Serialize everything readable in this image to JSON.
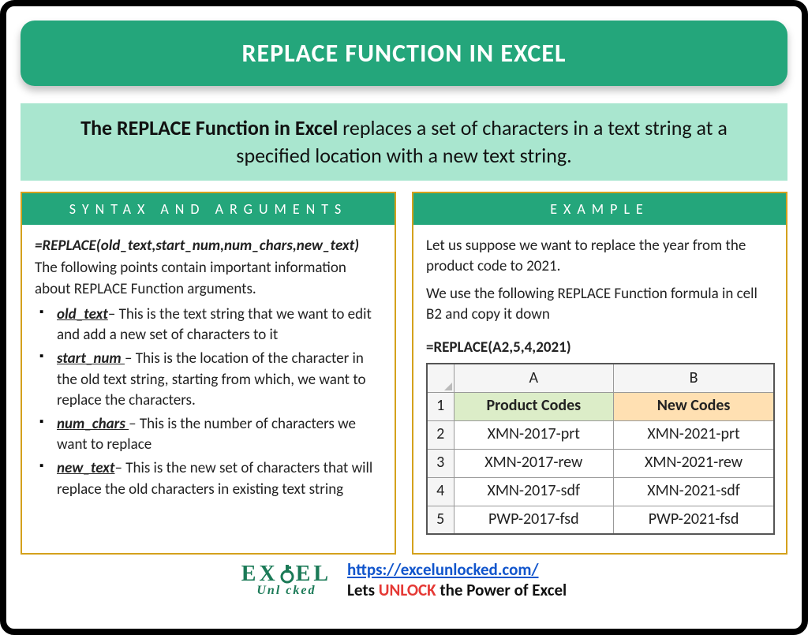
{
  "title": "REPLACE FUNCTION IN EXCEL",
  "description": {
    "bold": "The REPLACE Function in Excel",
    "rest": " replaces a set of characters in a text string at a specified location with a new text string."
  },
  "left": {
    "header": "SYNTAX AND ARGUMENTS",
    "syntax": "=REPLACE(old_text,start_num,num_chars,new_text)",
    "intro": "The following points contain important information about REPLACE Function arguments.",
    "args": [
      {
        "name": "old_text",
        "desc": "– This is the text string that we want to edit and add a new set of characters to it"
      },
      {
        "name": "start_num ",
        "desc": "– This is the location of the character in the old text string, starting from which, we want to replace the characters."
      },
      {
        "name": "num_chars ",
        "desc": "– This is the number of characters we want to replace"
      },
      {
        "name": "new_text",
        "desc": "– This is the new set of characters that will replace the old characters in existing text string"
      }
    ]
  },
  "right": {
    "header": "EXAMPLE",
    "p1": "Let us suppose we want to replace the year from the product code to 2021.",
    "p2": "We use the following REPLACE Function formula in cell B2 and copy it down",
    "formula": "=REPLACE(A2,5,4,2021)",
    "table": {
      "colA": "A",
      "colB": "B",
      "headers": {
        "a": "Product Codes",
        "b": "New Codes"
      },
      "rows": [
        {
          "n": "2",
          "a": "XMN-2017-prt",
          "b": "XMN-2021-prt"
        },
        {
          "n": "3",
          "a": "XMN-2017-rew",
          "b": "XMN-2021-rew"
        },
        {
          "n": "4",
          "a": "XMN-2017-sdf",
          "b": "XMN-2021-sdf"
        },
        {
          "n": "5",
          "a": "PWP-2017-fsd",
          "b": "PWP-2021-fsd"
        }
      ],
      "row1": "1"
    }
  },
  "footer": {
    "brand_top_pre": "EX",
    "brand_top_key": "C",
    "brand_top_post": "EL",
    "brand_bot": "Unl   cked",
    "url": "https://excelunlocked.com/",
    "tagline_pre": "Lets ",
    "tagline_unlock": "UNLOCK",
    "tagline_post": " the Power of Excel"
  },
  "chart_data": {
    "type": "table",
    "title": "REPLACE function example — replacing the year in product codes with 2021",
    "columns": [
      "Product Codes",
      "New Codes"
    ],
    "rows": [
      [
        "XMN-2017-prt",
        "XMN-2021-prt"
      ],
      [
        "XMN-2017-rew",
        "XMN-2021-rew"
      ],
      [
        "XMN-2017-sdf",
        "XMN-2021-sdf"
      ],
      [
        "PWP-2017-fsd",
        "PWP-2021-fsd"
      ]
    ],
    "formula": "=REPLACE(A2,5,4,2021)"
  }
}
